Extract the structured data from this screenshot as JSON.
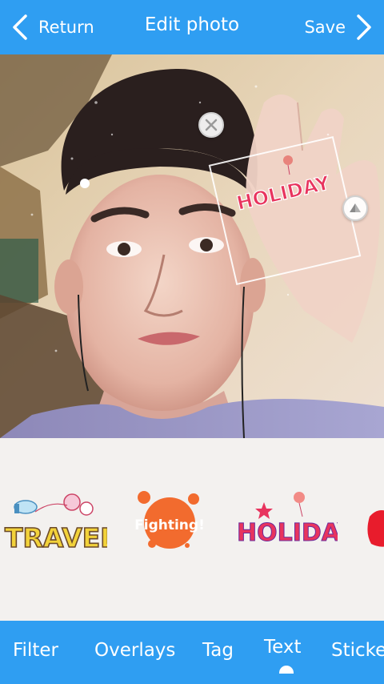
{
  "header": {
    "back_label": "Return",
    "title": "Edit photo",
    "save_label": "Save"
  },
  "canvas": {
    "sticker_text": "HOLIDAY"
  },
  "stickers": [
    {
      "text": "TRAVEL",
      "icon": "travel-sticker"
    },
    {
      "text": "Fighting!",
      "icon": "fighting-sticker"
    },
    {
      "text": "HOLIDAY",
      "icon": "holiday-sticker"
    },
    {
      "text": "",
      "icon": "red-sticker-partial"
    }
  ],
  "tabs": {
    "filter": "Filter",
    "overlays": "Overlays",
    "tag": "Tag",
    "text": "Text",
    "sticker": "Sticker"
  },
  "active_tab": "Text",
  "colors": {
    "accent": "#2f9ef2",
    "tray_bg": "#f3f1ef"
  }
}
